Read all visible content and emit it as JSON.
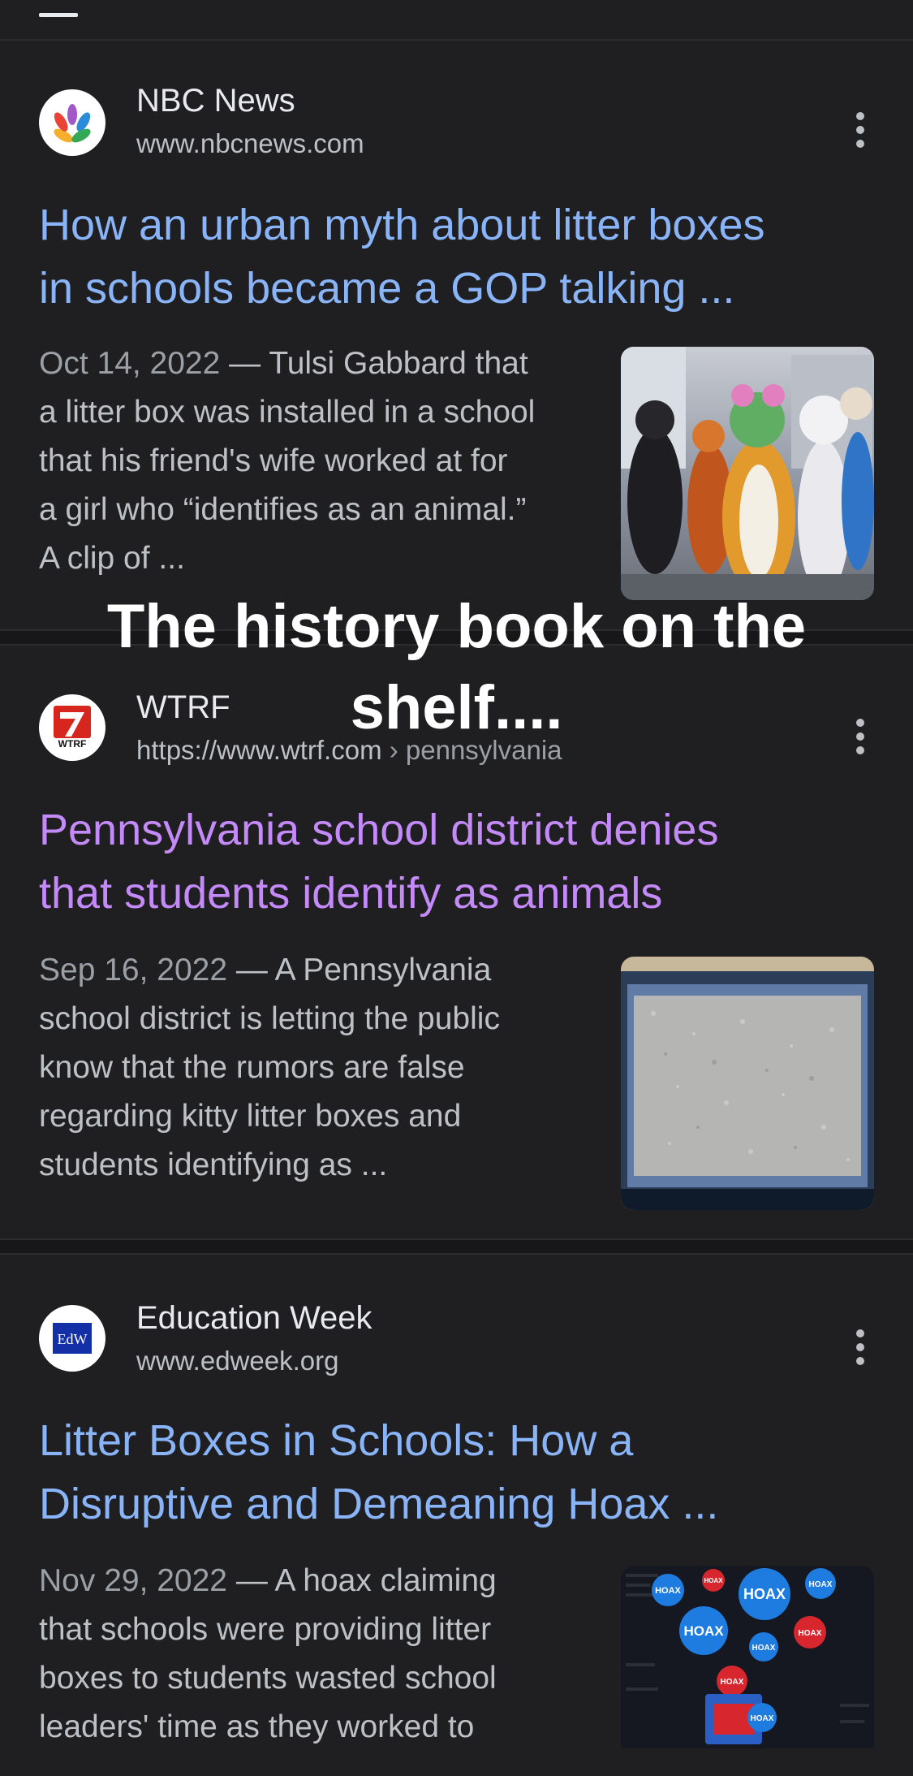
{
  "results": [
    {
      "source": "NBC News",
      "url": "www.nbcnews.com",
      "title_lines": [
        "How an urban myth about litter boxes",
        "in schools became a GOP talking ..."
      ],
      "date": "Oct 14, 2022",
      "snippet_lines": [
        "Tulsi Gabbard that",
        "a litter box was installed in a school",
        "that his friend's wife worked at for",
        "a girl who “identifies as an animal.”",
        "A clip of ..."
      ],
      "favicon": "nbc-peacock-icon",
      "thumbnail": "furry-costumes-photo"
    },
    {
      "source": "WTRF",
      "url": "https://www.wtrf.com",
      "url_crumb": " › pennsylvania",
      "title_lines": [
        "Pennsylvania school district denies",
        "that students identify as animals"
      ],
      "date": "Sep 16, 2022",
      "snippet_lines": [
        "A Pennsylvania",
        "school district is letting the public",
        "know that the rumors are false",
        "regarding kitty litter boxes and",
        "students identifying as ..."
      ],
      "favicon": "wtrf-7-logo-icon",
      "favicon_text": "WTRF",
      "thumbnail": "litter-box-photo"
    },
    {
      "source": "Education Week",
      "url": "www.edweek.org",
      "title_lines": [
        "Litter Boxes in Schools: How a",
        "Disruptive and Demeaning Hoax ..."
      ],
      "date": "Nov 29, 2022",
      "snippet_lines": [
        "A hoax claiming",
        "that schools were providing litter",
        "boxes to students wasted school",
        "leaders' time as they worked to"
      ],
      "favicon": "edweek-logo-icon",
      "favicon_text": "EdW",
      "thumbnail": "hoax-bubbles-image",
      "thumbnail_label": "HOAX"
    }
  ],
  "separator": "—",
  "overlay_caption": [
    "The history book on the",
    "shelf...."
  ],
  "colors": {
    "background": "#1f1f21",
    "link_unvisited": "#8ab4f8",
    "link_visited": "#c58af9",
    "snippet": "#bdc1c6"
  }
}
